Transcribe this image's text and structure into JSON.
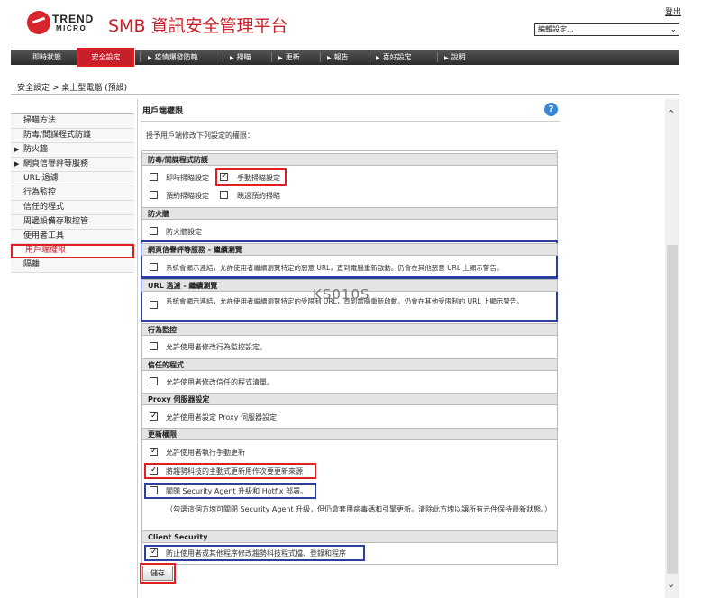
{
  "header": {
    "brand_top": "TREND",
    "brand_bottom": "MICRO",
    "app_title": "SMB 資訊安全管理平台",
    "logout": "登出",
    "edit_select": "編輯設定..."
  },
  "nav": [
    {
      "label": "即時狀態",
      "arrow": false
    },
    {
      "label": "安全設定",
      "arrow": false,
      "active": true
    },
    {
      "label": "疫情爆發防範",
      "arrow": true
    },
    {
      "label": "掃瞄",
      "arrow": true
    },
    {
      "label": "更新",
      "arrow": true
    },
    {
      "label": "報告",
      "arrow": true
    },
    {
      "label": "喜好設定",
      "arrow": true
    },
    {
      "label": "說明",
      "arrow": true
    }
  ],
  "breadcrumb": "安全設定 > 桌上型電腦 (預設)",
  "sidebar": [
    {
      "label": "掃瞄方法",
      "arrow": false
    },
    {
      "label": "防毒/間諜程式防護",
      "arrow": false
    },
    {
      "label": "防火牆",
      "arrow": true
    },
    {
      "label": "網頁信譽評等服務",
      "arrow": true
    },
    {
      "label": "URL 過濾",
      "arrow": false
    },
    {
      "label": "行為監控",
      "arrow": false
    },
    {
      "label": "信任的程式",
      "arrow": false
    },
    {
      "label": "周邊設備存取控管",
      "arrow": false
    },
    {
      "label": "使用者工具",
      "arrow": false
    },
    {
      "label": "用戶端權限",
      "arrow": false,
      "active": true
    },
    {
      "label": "隔離",
      "arrow": false
    }
  ],
  "content": {
    "title": "用戶端權限",
    "description": "授予用戶端修改下列設定的權限：",
    "watermark": "KS010S",
    "save": "儲存",
    "sections": {
      "antivirus": {
        "title": "防毒/間諜程式防護",
        "realtime": "即時掃瞄設定",
        "manual": "手動掃瞄設定",
        "scheduled": "預約掃瞄設定",
        "skip_scheduled": "跳過預約掃瞄"
      },
      "firewall": {
        "title": "防火牆",
        "item": "防火牆設定"
      },
      "web_reputation": {
        "title": "網頁信譽評等服務 - 繼續瀏覽",
        "item": "系統會顯示連結，允許使用者繼續瀏覽特定的惡意 URL，直到電腦重新啟動。仍會在其他惡意 URL 上顯示警告。"
      },
      "url_filter": {
        "title": "URL 過濾 - 繼續瀏覽",
        "item": "系統會顯示連結，允許使用者繼續瀏覽特定的受限制 URL，直到電腦重新啟動。仍會在其他受限制的 URL 上顯示警告。"
      },
      "behavior": {
        "title": "行為監控",
        "item": "允許使用者修改行為監控設定。"
      },
      "trusted": {
        "title": "信任的程式",
        "item": "允許使用者修改信任的程式清單。"
      },
      "proxy": {
        "title": "Proxy 伺服器設定",
        "item": "允許使用者設定 Proxy 伺服器設定"
      },
      "update": {
        "title": "更新權限",
        "manual": "允許使用者執行手動更新",
        "active_update": "將趨勢科技的主動式更新用作次要更新來源",
        "disable_upgrade": "關閉 Security Agent 升級和 Hotfix 部署。",
        "note": "（勾選這個方塊可關閉 Security Agent 升級，但仍會套用病毒碼和引擎更新。清除此方塊以讓所有元件保持最新狀態。）"
      },
      "client_security": {
        "title": "Client Security",
        "item": "防止使用者或其他程序修改趨勢科技程式檔、登錄和程序"
      }
    }
  }
}
